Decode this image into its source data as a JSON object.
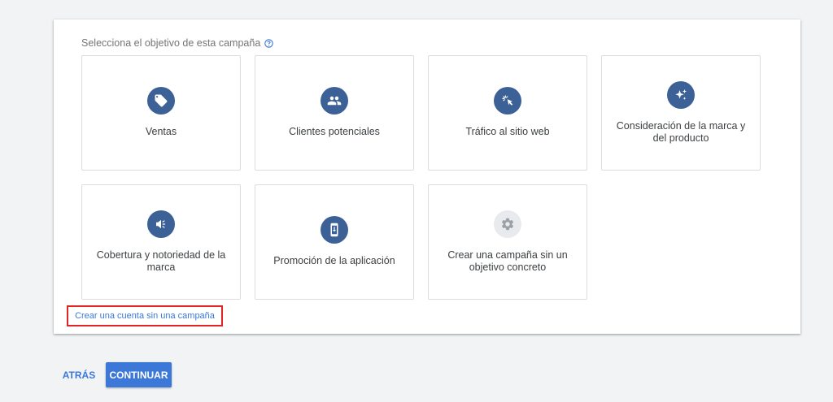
{
  "prompt": {
    "text": "Selecciona el objetivo de esta campaña",
    "help_icon": "help-circle-icon"
  },
  "goals": [
    {
      "label": "Ventas",
      "icon": "tag-icon"
    },
    {
      "label": "Clientes potenciales",
      "icon": "people-icon"
    },
    {
      "label": "Tráfico al sitio web",
      "icon": "cursor-click-icon"
    },
    {
      "label": "Consideración de la marca y del producto",
      "icon": "sparkle-icon"
    },
    {
      "label": "Cobertura y notoriedad de la marca",
      "icon": "megaphone-icon"
    },
    {
      "label": "Promoción de la aplicación",
      "icon": "phone-download-icon"
    },
    {
      "label": "Crear una campaña sin un objetivo concreto",
      "icon": "gear-icon"
    }
  ],
  "link": {
    "text": "Crear una cuenta sin una campaña"
  },
  "buttons": {
    "back": "ATRÁS",
    "continue": "CONTINUAR"
  },
  "colors": {
    "icon_bg": "#3c6196",
    "icon_bg_neutral": "#e8eaed",
    "accent": "#3c78d8",
    "highlight_border": "#e22424"
  }
}
